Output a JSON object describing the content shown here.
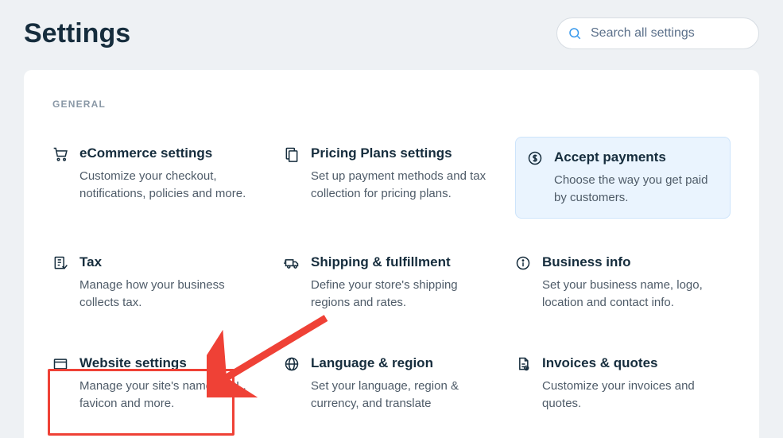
{
  "header": {
    "title": "Settings",
    "search_placeholder": "Search all settings"
  },
  "section_label": "GENERAL",
  "tiles": {
    "ecommerce": {
      "title": "eCommerce settings",
      "desc": "Customize your checkout, notifications, policies and more."
    },
    "pricing": {
      "title": "Pricing Plans settings",
      "desc": "Set up payment methods and tax collection for pricing plans."
    },
    "payments": {
      "title": "Accept payments",
      "desc": "Choose the way you get paid by customers."
    },
    "tax": {
      "title": "Tax",
      "desc": "Manage how your business collects tax."
    },
    "shipping": {
      "title": "Shipping & fulfillment",
      "desc": "Define your store's shipping regions and rates."
    },
    "business": {
      "title": "Business info",
      "desc": "Set your business name, logo, location and contact info."
    },
    "website": {
      "title": "Website settings",
      "desc": "Manage your site's name, URL, favicon and more."
    },
    "language": {
      "title": "Language & region",
      "desc": "Set your language, region & currency, and translate"
    },
    "invoices": {
      "title": "Invoices & quotes",
      "desc": "Customize your invoices and quotes."
    }
  }
}
